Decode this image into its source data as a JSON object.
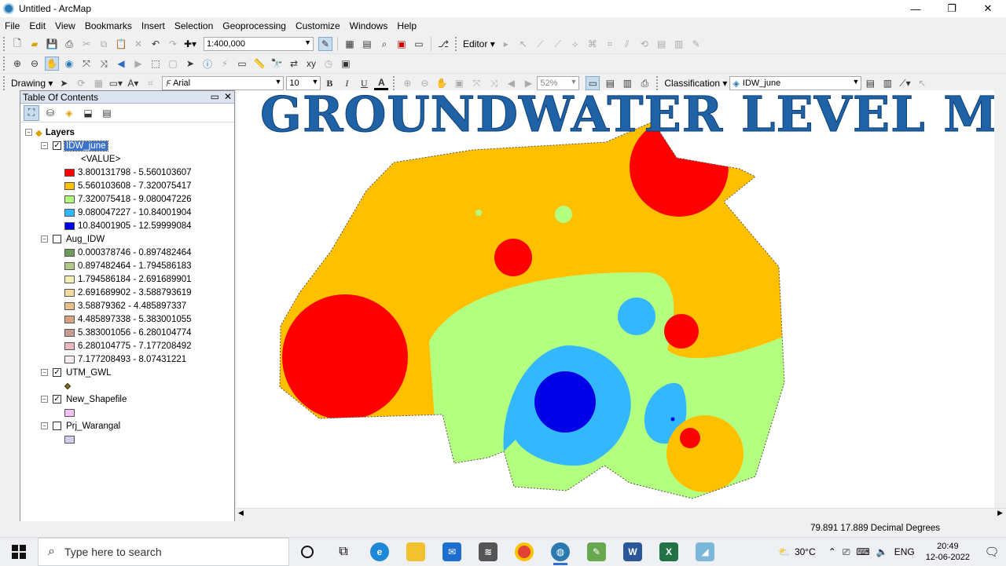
{
  "window": {
    "title": "Untitled - ArcMap",
    "controls": [
      "—",
      "❐",
      "✕"
    ]
  },
  "menu": [
    "File",
    "Edit",
    "View",
    "Bookmarks",
    "Insert",
    "Selection",
    "Geoprocessing",
    "Customize",
    "Windows",
    "Help"
  ],
  "toolbar": {
    "scale_value": "1:400,000",
    "editor_label": "Editor",
    "drawing_label": "Drawing",
    "font_name": "Arial",
    "font_size": "10",
    "bold": "B",
    "italic": "I",
    "underline": "U",
    "font_color": "A",
    "zoom_percent": "52%",
    "classification_label": "Classification",
    "layer_select": "IDW_june"
  },
  "toc": {
    "title": "Table Of Contents",
    "root": "Layers",
    "layers": [
      {
        "name": "IDW_june",
        "checked": true,
        "selected": true,
        "value_header": "<VALUE>",
        "classes": [
          {
            "label": "3.800131798 - 5.560103607",
            "color": "#ff0000"
          },
          {
            "label": "5.560103608 - 7.320075417",
            "color": "#ffc000"
          },
          {
            "label": "7.320075418 - 9.080047226",
            "color": "#b3ff80"
          },
          {
            "label": "9.080047227 - 10.84001904",
            "color": "#33b8ff"
          },
          {
            "label": "10.84001905 - 12.59999084",
            "color": "#0000e6"
          }
        ]
      },
      {
        "name": "Aug_IDW",
        "checked": false,
        "classes": [
          {
            "label": "0.000378746 - 0.897482464",
            "color": "#6f9a5a"
          },
          {
            "label": "0.897482464 - 1.794586183",
            "color": "#b3c98a"
          },
          {
            "label": "1.794586184 - 2.691689901",
            "color": "#f2efb4"
          },
          {
            "label": "2.691689902 - 3.588793619",
            "color": "#f3dba0"
          },
          {
            "label": "3.58879362 - 4.485897337",
            "color": "#e9bf8a"
          },
          {
            "label": "4.485897338 - 5.383001055",
            "color": "#d7a383"
          },
          {
            "label": "5.383001056 - 6.280104774",
            "color": "#c99b96"
          },
          {
            "label": "6.280104775 - 7.177208492",
            "color": "#e9b9bd"
          },
          {
            "label": "7.177208493 - 8.07431221",
            "color": "#f8eef4"
          }
        ]
      },
      {
        "name": "UTM_GWL",
        "checked": true,
        "symbol": "#8b6b00"
      },
      {
        "name": "New_Shapefile",
        "checked": true,
        "symbol": "#f3c2f3"
      },
      {
        "name": "Prj_Warangal",
        "checked": false,
        "symbol": "#d6ccee"
      }
    ]
  },
  "map": {
    "title": "GROUNDWATER LEVEL MAP",
    "colors": {
      "red": "#ff0000",
      "orange": "#ffc000",
      "green": "#b3ff80",
      "cyan": "#33b8ff",
      "blue": "#0000e6"
    }
  },
  "status": {
    "coords": "79.891  17.889 Decimal Degrees"
  },
  "taskbar": {
    "search_placeholder": "Type here to search",
    "weather": "30°C",
    "language": "ENG",
    "time": "20:49",
    "date": "12-06-2022"
  }
}
